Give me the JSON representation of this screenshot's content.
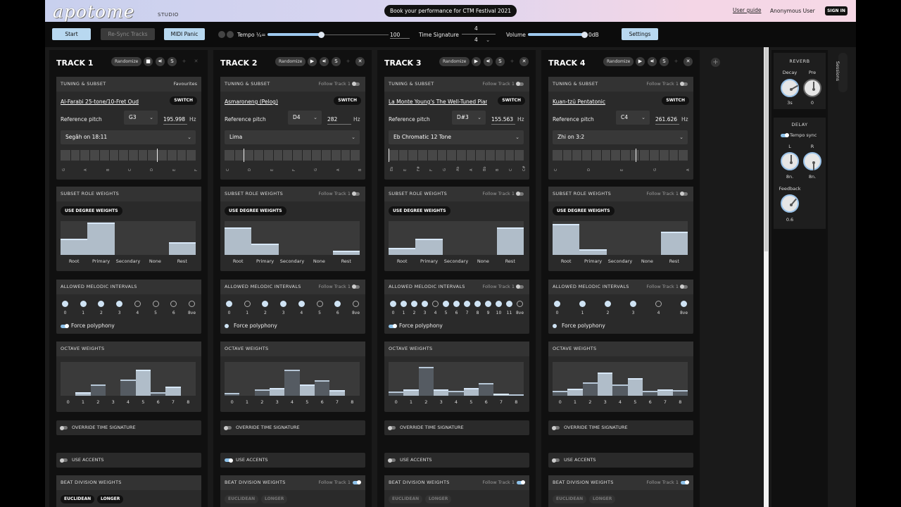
{
  "header": {
    "logo": "apotome",
    "logo_sub": "STUDIO",
    "banner": "Book your performance for CTM Festival 2021",
    "user_guide": "User guide",
    "user": "Anonymous User",
    "sign_in": "SIGN IN"
  },
  "toolbar": {
    "start": "Start",
    "resync": "Re-Sync Tracks",
    "midi_panic": "MIDI Panic",
    "tempo_label": "Tempo ¼=",
    "tempo_value": "100",
    "tempo_fraction": 0.44,
    "time_sig_label": "Time Signature",
    "time_sig_num": "4",
    "time_sig_den": "4",
    "volume_label": "Volume",
    "volume_value": "0dB",
    "volume_fraction": 0.95,
    "settings": "Settings"
  },
  "labels": {
    "randomize": "Randomize",
    "tuning_subset": "TUNING & SUBSET",
    "favourites": "Favourites",
    "follow": "Follow Track 1",
    "switch": "SWITCH",
    "reference_pitch": "Reference pitch",
    "hz": "Hz",
    "subset_role_weights": "SUBSET ROLE WEIGHTS",
    "use_degree_weights": "USE DEGREE WEIGHTS",
    "allowed_intervals": "ALLOWED MELODIC INTERVALS",
    "force_polyphony": "Force polyphony",
    "octave_weights": "OCTAVE WEIGHTS",
    "override_time_sig": "OVERRIDE TIME SIGNATURE",
    "use_accents": "USE ACCENTS",
    "beat_division": "BEAT DIVISION WEIGHTS",
    "euclidean": "EUCLIDEAN",
    "longer": "LONGER",
    "role_names": [
      "Root",
      "Primary",
      "Secondary",
      "None",
      "Rest"
    ],
    "octave_names": [
      "0",
      "1",
      "2",
      "3",
      "4",
      "5",
      "6",
      "7",
      "8"
    ]
  },
  "tracks": [
    {
      "title": "TRACK 1",
      "tuning": "Al-Farabi 25-tone/10-Fret Oud",
      "note": "G3",
      "hz": "195.998",
      "subset": "Segâh on 18:11",
      "key_labels": [
        "G",
        "A",
        "B",
        "C",
        "D",
        "E",
        "F"
      ],
      "roles": [
        0.5,
        1.0,
        0,
        0,
        0.4
      ],
      "intervals": [
        {
          "l": "0",
          "on": true
        },
        {
          "l": "1",
          "on": true
        },
        {
          "l": "2",
          "on": true
        },
        {
          "l": "3",
          "on": true
        },
        {
          "l": "4",
          "on": false
        },
        {
          "l": "5",
          "on": false
        },
        {
          "l": "6",
          "on": false
        },
        {
          "l": "8ve",
          "on": false
        }
      ],
      "force_on": true,
      "octaves": [
        0,
        0.1,
        0.35,
        0,
        0.5,
        0.8,
        0.1,
        0.28,
        0
      ],
      "accent_on": false
    },
    {
      "title": "TRACK 2",
      "tuning": "Asmaroneng (Pelog)",
      "note": "D4",
      "hz": "282",
      "subset": "Lima",
      "key_labels": [
        "C",
        "D",
        "E",
        "F",
        "G",
        "A",
        "B"
      ],
      "roles": [
        0.85,
        0.35,
        0,
        0,
        0.12
      ],
      "intervals": [
        {
          "l": "0",
          "on": true
        },
        {
          "l": "1",
          "on": false
        },
        {
          "l": "2",
          "on": true
        },
        {
          "l": "3",
          "on": true
        },
        {
          "l": "4",
          "on": true
        },
        {
          "l": "5",
          "on": false
        },
        {
          "l": "6",
          "on": true
        },
        {
          "l": "8ve",
          "on": false
        }
      ],
      "force_on": false,
      "octaves": [
        0.08,
        0,
        0.2,
        0.25,
        0.8,
        0.35,
        0.48,
        0.18,
        0
      ],
      "accent_on": true
    },
    {
      "title": "TRACK 3",
      "tuning": "La Monte Young's The Well-Tuned Piano",
      "note": "D#3",
      "hz": "155.563",
      "subset": "Eb Chromatic 12 Tone",
      "key_labels": [
        "Eb",
        "E",
        "F#",
        "F",
        "G",
        "Ab",
        "A",
        "Bb",
        "B",
        "C",
        "C#"
      ],
      "roles": [
        0.22,
        0.5,
        0,
        0,
        0.85
      ],
      "intervals": [
        {
          "l": "0",
          "on": true
        },
        {
          "l": "1",
          "on": true
        },
        {
          "l": "2",
          "on": true
        },
        {
          "l": "3",
          "on": true
        },
        {
          "l": "4",
          "on": false
        },
        {
          "l": "5",
          "on": true
        },
        {
          "l": "6",
          "on": true
        },
        {
          "l": "7",
          "on": true
        },
        {
          "l": "8",
          "on": true
        },
        {
          "l": "9",
          "on": true
        },
        {
          "l": "10",
          "on": true
        },
        {
          "l": "11",
          "on": true
        },
        {
          "l": "8ve",
          "on": false
        }
      ],
      "force_on": true,
      "octaves": [
        0.12,
        0.2,
        0.9,
        0.2,
        0.15,
        0.25,
        0.4,
        0.06,
        0.03
      ],
      "accent_on": false
    },
    {
      "title": "TRACK 4",
      "tuning": "Kuan-tzŭ Pentatonic",
      "note": "C4",
      "hz": "261.626",
      "subset": "Zhi on 3:2",
      "key_labels": [
        "C",
        "D",
        "E",
        "G",
        "A"
      ],
      "roles": [
        0.95,
        0.18,
        0,
        0,
        0.72
      ],
      "intervals": [
        {
          "l": "0",
          "on": true
        },
        {
          "l": "1",
          "on": true
        },
        {
          "l": "2",
          "on": true
        },
        {
          "l": "3",
          "on": true
        },
        {
          "l": "4",
          "on": false
        },
        {
          "l": "8ve",
          "on": true
        }
      ],
      "force_on": false,
      "octaves": [
        0.15,
        0.22,
        0.42,
        0.72,
        0.35,
        0.55,
        0.15,
        0.2,
        0.18
      ],
      "accent_on": false
    }
  ],
  "fx": {
    "reverb": "REVERB",
    "decay": "Decay",
    "pre": "Pre",
    "decay_value": "3s",
    "pre_value": "0",
    "delay": "DELAY",
    "tempo_sync": "Tempo sync",
    "l": "L",
    "r": "R",
    "l_value": "8n.",
    "r_value": "8n.",
    "feedback": "Feedback",
    "feedback_value": "0.6"
  },
  "sessions": "Sessions"
}
